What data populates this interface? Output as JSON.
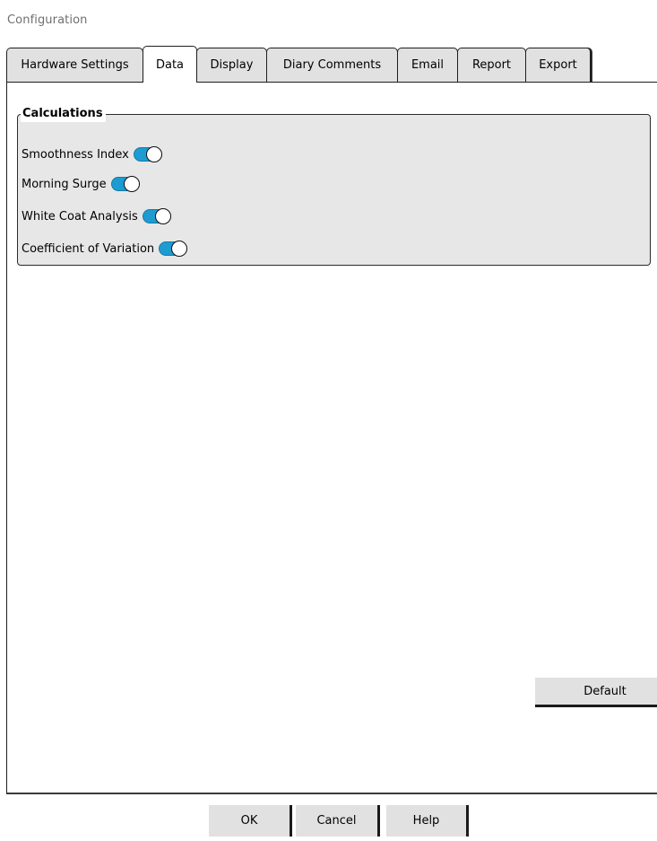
{
  "window": {
    "title": "Configuration"
  },
  "tabs": [
    {
      "label": "Hardware Settings",
      "active": false
    },
    {
      "label": "Data",
      "active": true
    },
    {
      "label": "Display",
      "active": false
    },
    {
      "label": "Diary Comments",
      "active": false
    },
    {
      "label": "Email",
      "active": false
    },
    {
      "label": "Report",
      "active": false
    },
    {
      "label": "Export",
      "active": false
    }
  ],
  "calculations": {
    "title": "Calculations",
    "options": [
      {
        "label": "Smoothness Index",
        "enabled": true
      },
      {
        "label": "Morning Surge",
        "enabled": true
      },
      {
        "label": "White Coat Analysis",
        "enabled": true
      },
      {
        "label": "Coefficient of Variation",
        "enabled": true
      }
    ]
  },
  "buttons": {
    "default": "Default",
    "ok": "OK",
    "cancel": "Cancel",
    "help": "Help"
  },
  "colors": {
    "toggle_on": "#1e9bd1",
    "tab_background": "#e1e1e1",
    "group_background": "#e7e7e7"
  }
}
